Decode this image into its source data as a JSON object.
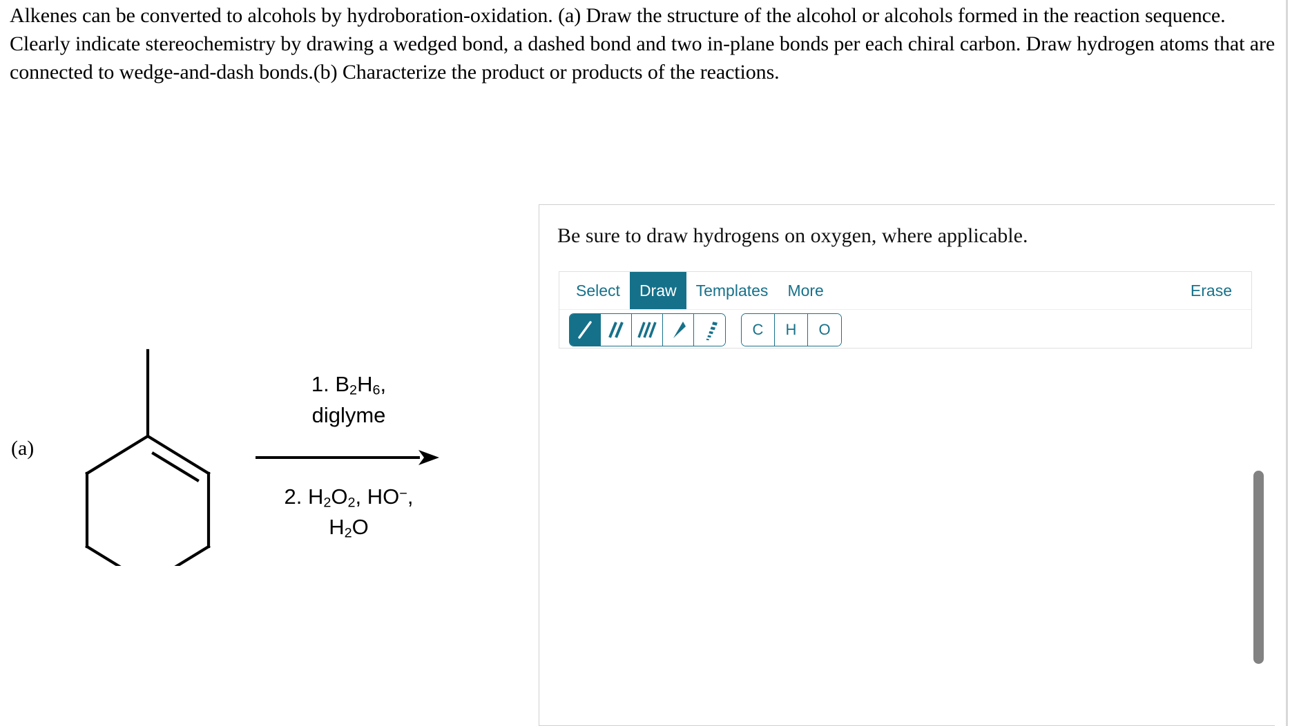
{
  "question": {
    "text": "Alkenes can be converted to alcohols by hydroboration-oxidation. (a) Draw the structure of the alcohol or alcohols formed in the reaction sequence. Clearly indicate stereochemistry by drawing a wedged bond, a dashed bond and two in-plane bonds per each chiral carbon. Draw hydrogen atoms that are connected to wedge-and-dash bonds.(b) Characterize the product or products of the reactions."
  },
  "reaction": {
    "part_label": "(a)",
    "substrate_name": "1-methylcyclohexene",
    "reagents": {
      "above_line1_prefix": "1. B",
      "above_line1_sub1": "2",
      "above_line1_mid": "H",
      "above_line1_sub2": "6",
      "above_line1_suffix": ",",
      "above_line2": "diglyme",
      "below_line1_prefix": "2. H",
      "below_line1_sub1": "2",
      "below_line1_mid1": "O",
      "below_line1_sub2": "2",
      "below_line1_mid2": ", HO",
      "below_line1_sup": "−",
      "below_line1_suffix": ",",
      "below_line2_prefix": "H",
      "below_line2_sub": "2",
      "below_line2_suffix": "O"
    },
    "arrow": "reaction-arrow-right"
  },
  "answer_panel": {
    "instruction": "Be sure to draw hydrogens on oxygen, where applicable.",
    "toolbar": {
      "tabs": [
        {
          "label": "Select",
          "active": false
        },
        {
          "label": "Draw",
          "active": true
        },
        {
          "label": "Templates",
          "active": false
        },
        {
          "label": "More",
          "active": false
        }
      ],
      "erase_label": "Erase",
      "bond_tools": [
        {
          "name": "single-bond-tool",
          "icon": "single-bond",
          "selected": true
        },
        {
          "name": "double-bond-tool",
          "icon": "double-bond",
          "selected": false
        },
        {
          "name": "triple-bond-tool",
          "icon": "triple-bond",
          "selected": false
        },
        {
          "name": "wedge-bond-tool",
          "icon": "wedge-bond",
          "selected": false
        },
        {
          "name": "hash-bond-tool",
          "icon": "hashed-wedge-bond",
          "selected": false
        }
      ],
      "element_tools": [
        {
          "label": "C"
        },
        {
          "label": "H"
        },
        {
          "label": "O"
        }
      ]
    },
    "canvas_content": ""
  },
  "colors": {
    "accent_teal": "#15718a",
    "panel_border": "#cfcfcf",
    "toolbar_border": "#e0e0e0",
    "scrollbar_thumb": "#828282",
    "text_black": "#000000"
  },
  "scrollbar": {
    "orientation": "vertical",
    "position": "right"
  }
}
